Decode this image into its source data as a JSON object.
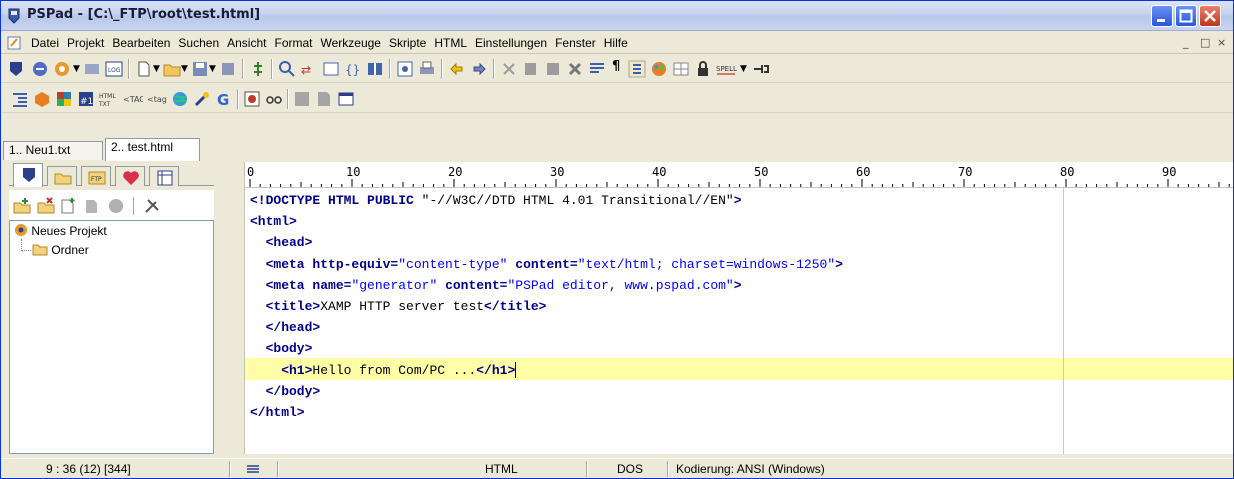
{
  "window": {
    "title": "PSPad - [C:\\_FTP\\root\\test.html]"
  },
  "menu": {
    "items": [
      "Datei",
      "Projekt",
      "Bearbeiten",
      "Suchen",
      "Ansicht",
      "Format",
      "Werkzeuge",
      "Skripte",
      "HTML",
      "Einstellungen",
      "Fenster",
      "Hilfe"
    ],
    "mdi_min": "_",
    "mdi_restore": "□",
    "mdi_close": "×"
  },
  "tabs": [
    {
      "label": "1.. Neu1.txt"
    },
    {
      "label": "2.. test.html"
    }
  ],
  "project": {
    "root": "Neues Projekt",
    "folder": "Ordner"
  },
  "ruler": {
    "marks": [
      "0",
      "10",
      "20",
      "30",
      "40",
      "50",
      "60",
      "70",
      "80",
      "90"
    ]
  },
  "editor": {
    "lines": [
      [
        {
          "t": "<!DOCTYPE HTML PUBLIC ",
          "c": "kw"
        },
        {
          "t": "\"-//W3C//DTD HTML 4.01 Transitional//EN\"",
          "c": "pl"
        },
        {
          "t": ">",
          "c": "kw"
        }
      ],
      [
        {
          "t": "<html>",
          "c": "kw"
        }
      ],
      [
        {
          "t": "  <head>",
          "c": "kw"
        }
      ],
      [
        {
          "t": "  <meta ",
          "c": "kw"
        },
        {
          "t": "http-equiv=",
          "c": "attr"
        },
        {
          "t": "\"content-type\"",
          "c": "str"
        },
        {
          "t": " content=",
          "c": "attr"
        },
        {
          "t": "\"text/html; charset=windows-1250\"",
          "c": "str"
        },
        {
          "t": ">",
          "c": "kw"
        }
      ],
      [
        {
          "t": "  <meta ",
          "c": "kw"
        },
        {
          "t": "name=",
          "c": "attr"
        },
        {
          "t": "\"generator\"",
          "c": "str"
        },
        {
          "t": " content=",
          "c": "attr"
        },
        {
          "t": "\"PSPad editor, www.pspad.com\"",
          "c": "str"
        },
        {
          "t": ">",
          "c": "kw"
        }
      ],
      [
        {
          "t": "  <title>",
          "c": "kw"
        },
        {
          "t": "XAMP HTTP server test",
          "c": "pl"
        },
        {
          "t": "</title>",
          "c": "kw"
        }
      ],
      [
        {
          "t": "  </head>",
          "c": "kw"
        }
      ],
      [
        {
          "t": "  <body>",
          "c": "kw"
        }
      ],
      [
        {
          "t": "    <h1>",
          "c": "kw"
        },
        {
          "t": "Hello from Com/PC ...",
          "c": "pl"
        },
        {
          "t": "</h1>",
          "c": "kw"
        }
      ],
      [
        {
          "t": "  </body>",
          "c": "kw"
        }
      ],
      [
        {
          "t": "</html>",
          "c": "kw"
        }
      ]
    ],
    "current_line": 9
  },
  "status": {
    "position": "9 : 36  (12)  [344]",
    "syntax": "HTML",
    "line_end": "DOS",
    "encoding": "Kodierung: ANSI (Windows)"
  },
  "colors": {
    "highlight": "#ffff99",
    "tag": "#00008b",
    "string": "#0000ff"
  }
}
